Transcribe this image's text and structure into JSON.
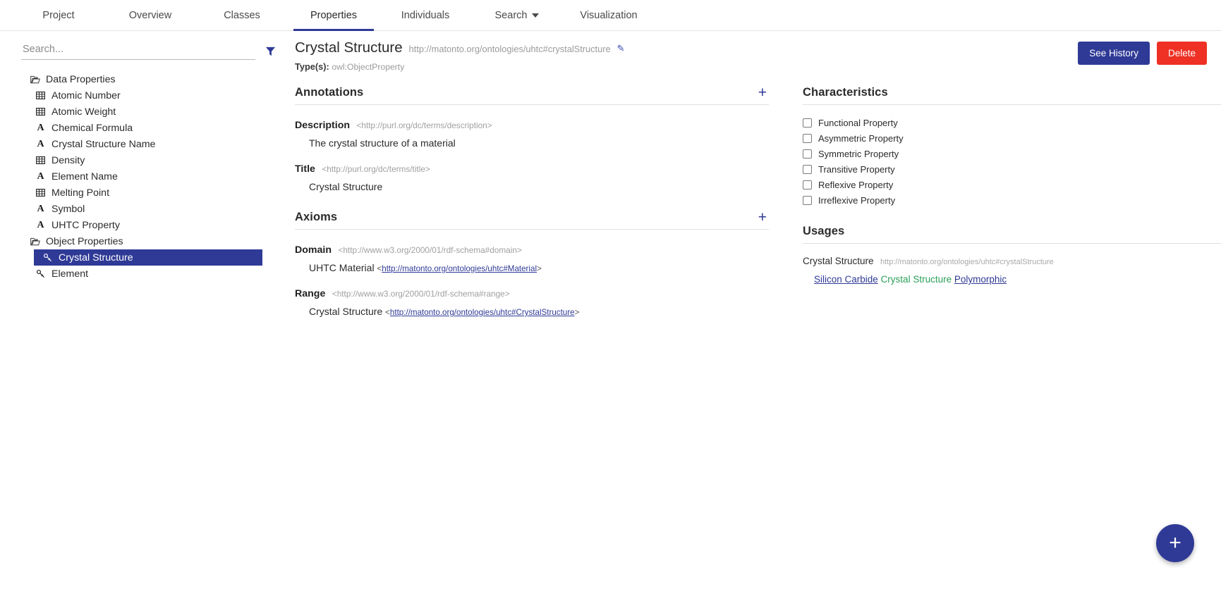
{
  "topnav": {
    "items": [
      {
        "label": "Project",
        "active": false,
        "dropdown": false
      },
      {
        "label": "Overview",
        "active": false,
        "dropdown": false
      },
      {
        "label": "Classes",
        "active": false,
        "dropdown": false
      },
      {
        "label": "Properties",
        "active": true,
        "dropdown": false
      },
      {
        "label": "Individuals",
        "active": false,
        "dropdown": false
      },
      {
        "label": "Search",
        "active": false,
        "dropdown": true
      },
      {
        "label": "Visualization",
        "active": false,
        "dropdown": false
      }
    ]
  },
  "sidebar": {
    "search": {
      "value": "",
      "placeholder": "Search..."
    },
    "filter_icon": "filter-funnel-icon",
    "tree": [
      {
        "label": "Data Properties",
        "icon": "folder-open-icon",
        "level": 0,
        "selected": false
      },
      {
        "label": "Atomic Number",
        "icon": "datatype-grid-icon",
        "level": 1,
        "selected": false
      },
      {
        "label": "Atomic Weight",
        "icon": "datatype-grid-icon",
        "level": 1,
        "selected": false
      },
      {
        "label": "Chemical Formula",
        "icon": "datatype-text-icon",
        "level": 1,
        "selected": false
      },
      {
        "label": "Crystal Structure Name",
        "icon": "datatype-text-icon",
        "level": 1,
        "selected": false
      },
      {
        "label": "Density",
        "icon": "datatype-grid-icon",
        "level": 1,
        "selected": false
      },
      {
        "label": "Element Name",
        "icon": "datatype-text-icon",
        "level": 1,
        "selected": false
      },
      {
        "label": "Melting Point",
        "icon": "datatype-grid-icon",
        "level": 1,
        "selected": false
      },
      {
        "label": "Symbol",
        "icon": "datatype-text-icon",
        "level": 1,
        "selected": false
      },
      {
        "label": "UHTC Property",
        "icon": "datatype-text-icon",
        "level": 1,
        "selected": false
      },
      {
        "label": "Object Properties",
        "icon": "folder-open-icon",
        "level": 0,
        "selected": false
      },
      {
        "label": "Crystal Structure",
        "icon": "object-link-icon",
        "level": 1,
        "selected": true
      },
      {
        "label": "Element",
        "icon": "object-link-icon",
        "level": 1,
        "selected": false
      }
    ]
  },
  "header": {
    "title": "Crystal Structure",
    "iri": "http://matonto.org/ontologies/uhtc#crystalStructure",
    "edit_icon": "pencil-icon",
    "types_label": "Type(s):",
    "types_value": "owl:ObjectProperty",
    "see_history_label": "See History",
    "delete_label": "Delete"
  },
  "annotations": {
    "title": "Annotations",
    "add_icon": "plus-icon",
    "items": [
      {
        "label": "Description",
        "iri": "<http://purl.org/dc/terms/description>",
        "value": "The crystal structure of a material"
      },
      {
        "label": "Title",
        "iri": "<http://purl.org/dc/terms/title>",
        "value": "Crystal Structure"
      }
    ]
  },
  "axioms": {
    "title": "Axioms",
    "add_icon": "plus-icon",
    "items": [
      {
        "label": "Domain",
        "iri": "<http://www.w3.org/2000/01/rdf-schema#domain>",
        "value_name": "UHTC Material",
        "value_iri": "http://matonto.org/ontologies/uhtc#Material"
      },
      {
        "label": "Range",
        "iri": "<http://www.w3.org/2000/01/rdf-schema#range>",
        "value_name": "Crystal Structure",
        "value_iri": "http://matonto.org/ontologies/uhtc#CrystalStructure"
      }
    ]
  },
  "characteristics": {
    "title": "Characteristics",
    "items": [
      {
        "label": "Functional Property",
        "checked": false
      },
      {
        "label": "Asymmetric Property",
        "checked": false
      },
      {
        "label": "Symmetric Property",
        "checked": false
      },
      {
        "label": "Transitive Property",
        "checked": false
      },
      {
        "label": "Reflexive Property",
        "checked": false
      },
      {
        "label": "Irreflexive Property",
        "checked": false
      }
    ]
  },
  "usages": {
    "title": "Usages",
    "add_icon": "plus-icon",
    "entity_name": "Crystal Structure",
    "entity_iri": "http://matonto.org/ontologies/uhtc#crystalStructure",
    "triple": {
      "subject": "Silicon Carbide",
      "predicate": "Crystal Structure",
      "object": "Polymorphic"
    }
  },
  "fab": {
    "icon": "plus-icon",
    "label": "+"
  },
  "colors": {
    "accent": "#2f3a96",
    "danger": "#ee3124",
    "link": "#2f3a96",
    "predicate_green": "#2aa05a",
    "muted": "#9b9b9b"
  }
}
